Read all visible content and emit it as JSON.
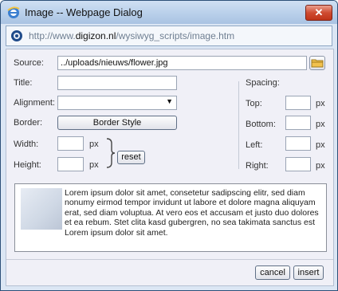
{
  "window": {
    "title": "Image -- Webpage Dialog",
    "close_label": "✕"
  },
  "address": {
    "prefix": "http://www.",
    "domain": "digizon.nl",
    "path": "/wysiwyg_scripts/image.htm"
  },
  "form": {
    "source_label": "Source:",
    "source_value": "../uploads/nieuws/flower.jpg",
    "title_label": "Title:",
    "title_value": "",
    "alignment_label": "Alignment:",
    "alignment_value": "",
    "border_label": "Border:",
    "border_button": "Border Style",
    "width_label": "Width:",
    "height_label": "Height:",
    "width_value": "",
    "height_value": "",
    "unit": "px",
    "reset_button": "reset"
  },
  "spacing": {
    "label": "Spacing:",
    "top_label": "Top:",
    "bottom_label": "Bottom:",
    "left_label": "Left:",
    "right_label": "Right:",
    "unit": "px"
  },
  "preview": {
    "text": "Lorem ipsum dolor sit amet, consetetur sadipscing elitr, sed diam nonumy eirmod tempor invidunt ut labore et dolore magna aliquyam erat, sed diam voluptua. At vero eos et accusam et justo duo dolores et ea rebum. Stet clita kasd gubergren, no sea takimata sanctus est Lorem ipsum dolor sit amet."
  },
  "actions": {
    "cancel": "cancel",
    "insert": "insert"
  },
  "colors": {
    "title_gradient_top": "#cfe0f3",
    "window_bg": "#dbe6f4",
    "content_bg": "#f0f0f7",
    "close_red": "#c03419"
  }
}
